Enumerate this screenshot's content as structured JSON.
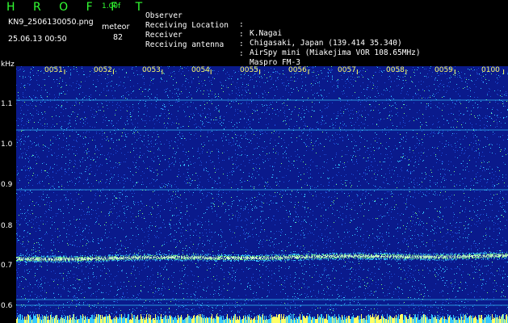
{
  "header": {
    "app_title": "H R O F F T",
    "version": "1.00f",
    "filename": "KN9_2506130050.png",
    "datetime": "25.06.13 00:50",
    "meteor_label": "meteor",
    "meteor_count": "82"
  },
  "info": [
    {
      "key": "Observer",
      "value": "K.Nagai"
    },
    {
      "key": "Receiving Location",
      "value": "Chigasaki, Japan (139.414 35.340)"
    },
    {
      "key": "Receiver",
      "value": "AirSpy mini (Miakejima VOR 108.65MHz)"
    },
    {
      "key": "Receiving antenna",
      "value": "Maspro FM-3"
    }
  ],
  "axis": {
    "unit": "kHz",
    "y_ticks": [
      "1.1",
      "1.0",
      "0.9",
      "0.8",
      "0.7",
      "0.6"
    ],
    "time_labels": [
      "0051",
      "0052",
      "0053",
      "0054",
      "0055",
      "0056",
      "0057",
      "0058",
      "0059",
      "0100"
    ]
  },
  "colors": {
    "background": "#0a1a8c",
    "noise_blue": "#1e4fd8",
    "noise_cyan": "#36c8ff",
    "noise_green": "#7dff7d",
    "carrier": "#c8ffc8",
    "label_yellow": "#ffff66",
    "label_green": "#33ff33"
  }
}
